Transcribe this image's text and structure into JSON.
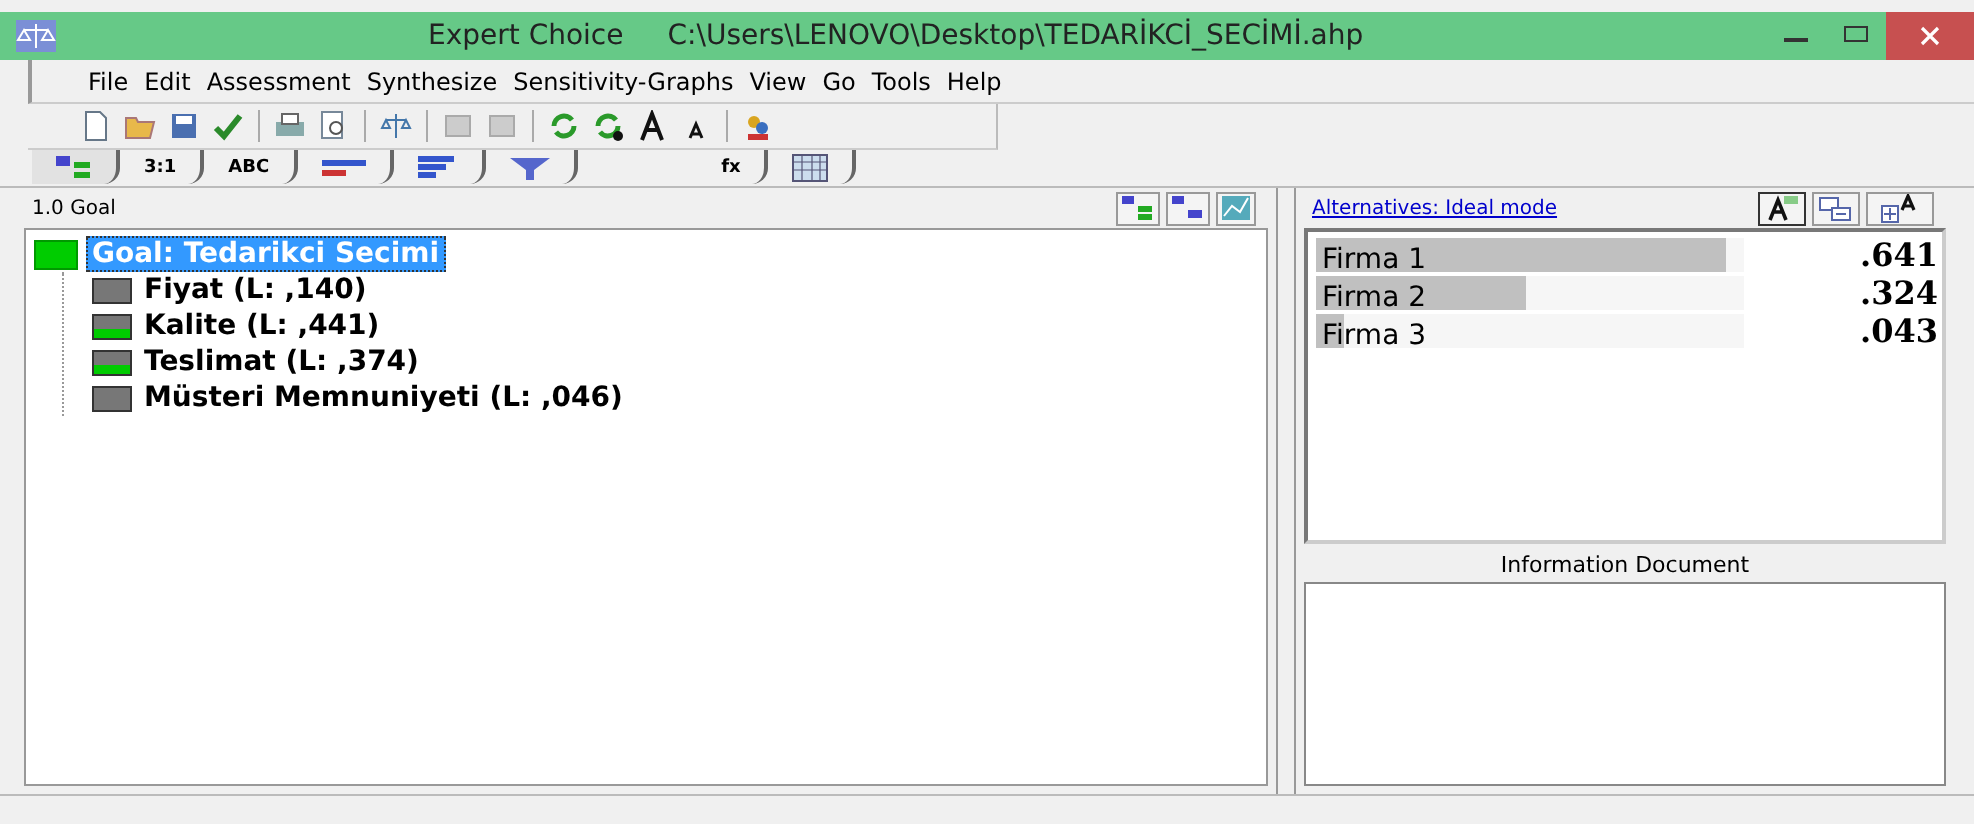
{
  "window": {
    "title": "Expert Choice",
    "path": "C:\\Users\\LENOVO\\Desktop\\TEDARİKCİ_SECİMİ.ahp"
  },
  "menu": [
    {
      "label": "File"
    },
    {
      "label": "Edit"
    },
    {
      "label": "Assessment"
    },
    {
      "label": "Synthesize"
    },
    {
      "label": "Sensitivity-Graphs"
    },
    {
      "label": "View"
    },
    {
      "label": "Go"
    },
    {
      "label": "Tools"
    },
    {
      "label": "Help"
    }
  ],
  "tabs": [
    {
      "kind": "tree",
      "selected": true
    },
    {
      "kind": "text",
      "text": "3:1",
      "selected": false
    },
    {
      "kind": "text",
      "text": "ABC",
      "selected": false
    },
    {
      "kind": "bars",
      "selected": false
    },
    {
      "kind": "lines",
      "selected": false
    },
    {
      "kind": "funnel",
      "selected": false
    },
    {
      "kind": "text",
      "text": "fx",
      "selected": false
    },
    {
      "kind": "grid",
      "selected": false
    }
  ],
  "tree_header": "1.0 Goal",
  "goal": {
    "label": "Goal: Tedarikci Secimi",
    "kind": "full",
    "selected": true,
    "children": [
      {
        "label": "Fiyat (L: ,140)",
        "kind": "empty"
      },
      {
        "label": "Kalite (L: ,441)",
        "kind": "partial"
      },
      {
        "label": "Teslimat (L: ,374)",
        "kind": "partial"
      },
      {
        "label": "Müsteri Memnuniyeti (L: ,046)",
        "kind": "empty"
      }
    ]
  },
  "alternatives_link": "Alternatives: Ideal mode",
  "alternatives": [
    {
      "name": "Firma 1",
      "level": 1,
      "value": ".641"
    },
    {
      "name": "Firma 2",
      "level": 0.51,
      "value": ".324"
    },
    {
      "name": "Firma 3",
      "level": 0.07,
      "value": ".043"
    }
  ],
  "info_title": "Information Document"
}
